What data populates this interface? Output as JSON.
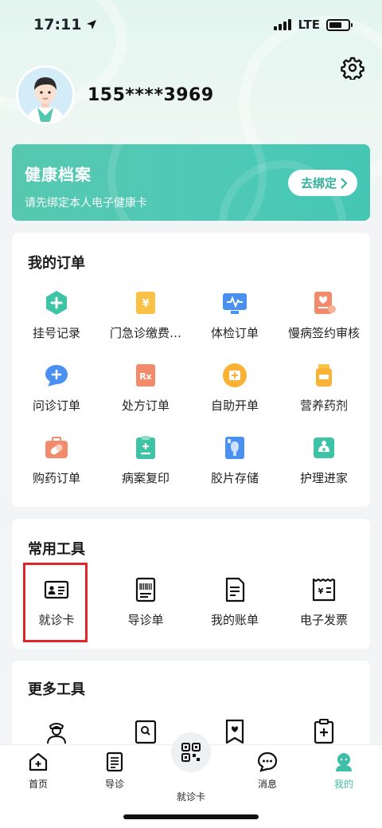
{
  "status_bar": {
    "time": "17:11",
    "network": "LTE"
  },
  "profile": {
    "phone": "155****3969"
  },
  "health_card": {
    "title": "健康档案",
    "subtitle": "请先绑定本人电子健康卡",
    "button": "去绑定"
  },
  "orders": {
    "title": "我的订单",
    "items": [
      {
        "label": "挂号记录",
        "icon": "register-record-icon"
      },
      {
        "label": "门急诊缴费…",
        "icon": "payment-icon"
      },
      {
        "label": "体检订单",
        "icon": "checkup-icon"
      },
      {
        "label": "慢病签约审核",
        "icon": "chronic-icon"
      },
      {
        "label": "问诊订单",
        "icon": "consult-icon"
      },
      {
        "label": "处方订单",
        "icon": "prescription-icon"
      },
      {
        "label": "自助开单",
        "icon": "self-order-icon"
      },
      {
        "label": "营养药剂",
        "icon": "nutrition-icon"
      },
      {
        "label": "购药订单",
        "icon": "medicine-icon"
      },
      {
        "label": "病案复印",
        "icon": "record-copy-icon"
      },
      {
        "label": "胶片存储",
        "icon": "film-icon"
      },
      {
        "label": "护理进家",
        "icon": "home-care-icon"
      }
    ]
  },
  "tools": {
    "title": "常用工具",
    "items": [
      {
        "label": "就诊卡",
        "icon": "id-card-icon"
      },
      {
        "label": "导诊单",
        "icon": "barcode-doc-icon"
      },
      {
        "label": "我的账单",
        "icon": "bill-icon"
      },
      {
        "label": "电子发票",
        "icon": "invoice-icon"
      }
    ]
  },
  "more_tools": {
    "title": "更多工具",
    "items": [
      {
        "icon": "nurse-icon"
      },
      {
        "icon": "search-doc-icon"
      },
      {
        "icon": "bookmark-heart-icon"
      },
      {
        "icon": "clipboard-plus-icon"
      }
    ]
  },
  "tabbar": {
    "items": [
      {
        "label": "首页",
        "icon": "home-icon"
      },
      {
        "label": "导诊",
        "icon": "guide-icon"
      },
      {
        "label": "就诊卡",
        "icon": "qr-icon"
      },
      {
        "label": "消息",
        "icon": "message-icon"
      },
      {
        "label": "我的",
        "icon": "profile-icon"
      }
    ]
  },
  "colors": {
    "accent": "#3fbfa7",
    "highlight": "#e0262b"
  }
}
